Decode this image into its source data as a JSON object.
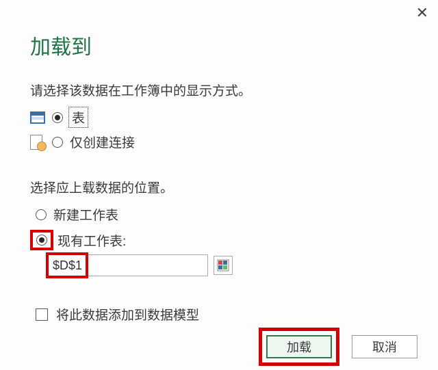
{
  "dialog": {
    "title": "加载到",
    "close_label": "✕"
  },
  "displaySection": {
    "prompt": "请选择该数据在工作簿中的显示方式。",
    "options": {
      "table": {
        "selected": true,
        "label": "表"
      },
      "connection_only": {
        "selected": false,
        "label": "仅创建连接"
      }
    }
  },
  "locationSection": {
    "prompt": "选择应上载数据的位置。",
    "options": {
      "new_sheet": {
        "selected": false,
        "label": "新建工作表"
      },
      "existing_sheet": {
        "selected": true,
        "label": "现有工作表:"
      }
    },
    "cell_reference": "$D$1"
  },
  "dataModel": {
    "checked": false,
    "label": "将此数据添加到数据模型"
  },
  "buttons": {
    "load": "加载",
    "cancel": "取消"
  }
}
